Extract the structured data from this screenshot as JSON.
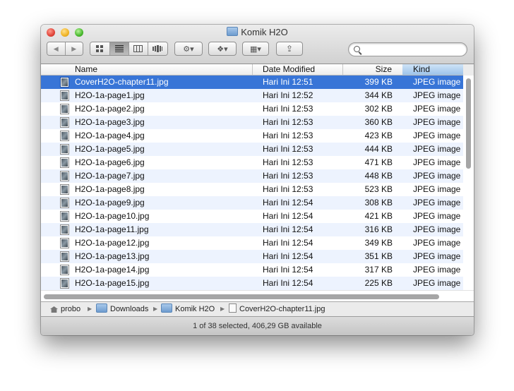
{
  "window": {
    "title": "Komik H2O"
  },
  "toolbar": {
    "back_glyph": "◀",
    "forward_glyph": "▶",
    "views": [
      {
        "icon": "icon-view-icon"
      },
      {
        "icon": "list-view-icon"
      },
      {
        "icon": "column-view-icon"
      },
      {
        "icon": "coverflow-view-icon"
      }
    ],
    "action_glyph": "⚙▾",
    "dropbox_glyph": "❖▾",
    "arrange_glyph": "▦▾",
    "share_glyph": "⇪",
    "search_placeholder": ""
  },
  "columns": {
    "name": "Name",
    "date": "Date Modified",
    "size": "Size",
    "kind": "Kind"
  },
  "files": [
    {
      "name": "CoverH2O-chapter11.jpg",
      "date": "Hari Ini 12:51",
      "size": "399 KB",
      "kind": "JPEG image"
    },
    {
      "name": "H2O-1a-page1.jpg",
      "date": "Hari Ini 12:52",
      "size": "344 KB",
      "kind": "JPEG image"
    },
    {
      "name": "H2O-1a-page2.jpg",
      "date": "Hari Ini 12:53",
      "size": "302 KB",
      "kind": "JPEG image"
    },
    {
      "name": "H2O-1a-page3.jpg",
      "date": "Hari Ini 12:53",
      "size": "360 KB",
      "kind": "JPEG image"
    },
    {
      "name": "H2O-1a-page4.jpg",
      "date": "Hari Ini 12:53",
      "size": "423 KB",
      "kind": "JPEG image"
    },
    {
      "name": "H2O-1a-page5.jpg",
      "date": "Hari Ini 12:53",
      "size": "444 KB",
      "kind": "JPEG image"
    },
    {
      "name": "H2O-1a-page6.jpg",
      "date": "Hari Ini 12:53",
      "size": "471 KB",
      "kind": "JPEG image"
    },
    {
      "name": "H2O-1a-page7.jpg",
      "date": "Hari Ini 12:53",
      "size": "448 KB",
      "kind": "JPEG image"
    },
    {
      "name": "H2O-1a-page8.jpg",
      "date": "Hari Ini 12:53",
      "size": "523 KB",
      "kind": "JPEG image"
    },
    {
      "name": "H2O-1a-page9.jpg",
      "date": "Hari Ini 12:54",
      "size": "308 KB",
      "kind": "JPEG image"
    },
    {
      "name": "H2O-1a-page10.jpg",
      "date": "Hari Ini 12:54",
      "size": "421 KB",
      "kind": "JPEG image"
    },
    {
      "name": "H2O-1a-page11.jpg",
      "date": "Hari Ini 12:54",
      "size": "316 KB",
      "kind": "JPEG image"
    },
    {
      "name": "H2O-1a-page12.jpg",
      "date": "Hari Ini 12:54",
      "size": "349 KB",
      "kind": "JPEG image"
    },
    {
      "name": "H2O-1a-page13.jpg",
      "date": "Hari Ini 12:54",
      "size": "351 KB",
      "kind": "JPEG image"
    },
    {
      "name": "H2O-1a-page14.jpg",
      "date": "Hari Ini 12:54",
      "size": "317 KB",
      "kind": "JPEG image"
    },
    {
      "name": "H2O-1a-page15.jpg",
      "date": "Hari Ini 12:54",
      "size": "225 KB",
      "kind": "JPEG image"
    }
  ],
  "selected_index": 0,
  "path": {
    "items": [
      "probo",
      "Downloads",
      "Komik H2O",
      "CoverH2O-chapter11.jpg"
    ],
    "separator": "▶"
  },
  "status": "1 of 38 selected, 406,29 GB available",
  "colors": {
    "selection": "#3875d7",
    "alt_row": "#edf3fe",
    "kind_header": "#b4d3f1"
  }
}
